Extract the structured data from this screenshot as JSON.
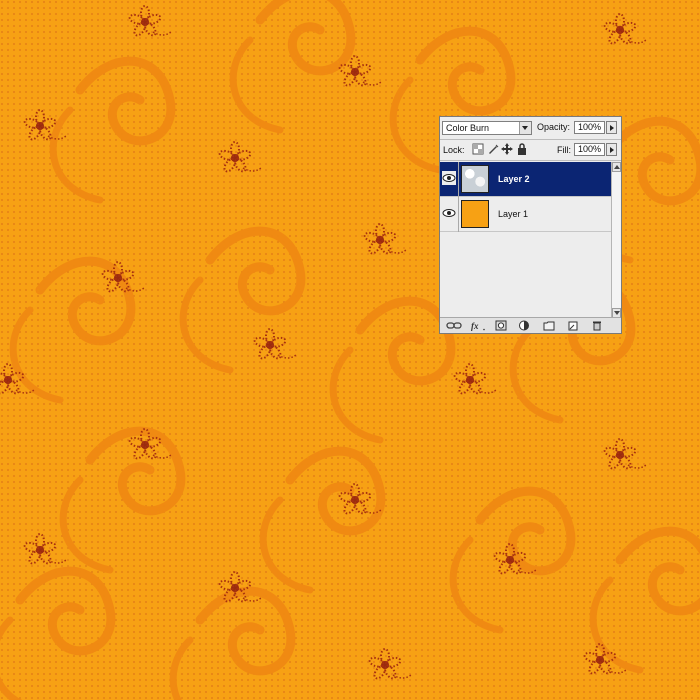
{
  "canvas": {
    "background": "#f7a114",
    "pattern_color": "#b33a12",
    "swirl_color": "#f28c13"
  },
  "layers_panel": {
    "blend_mode": "Color Burn",
    "opacity_label": "Opacity:",
    "opacity_value": "100%",
    "lock_label": "Lock:",
    "fill_label": "Fill:",
    "fill_value": "100%",
    "selected_color": "#0b2573",
    "layers": [
      {
        "name": "Layer 2",
        "visible": true,
        "selected": true,
        "thumbnail": "noise-texture"
      },
      {
        "name": "Layer 1",
        "visible": true,
        "selected": false,
        "thumbnail": "orange-fill"
      }
    ],
    "toolbar_icons": [
      "link-icon",
      "fx-icon",
      "mask-icon",
      "adjustment-icon",
      "group-folder-icon",
      "new-layer-icon",
      "trash-icon"
    ]
  }
}
